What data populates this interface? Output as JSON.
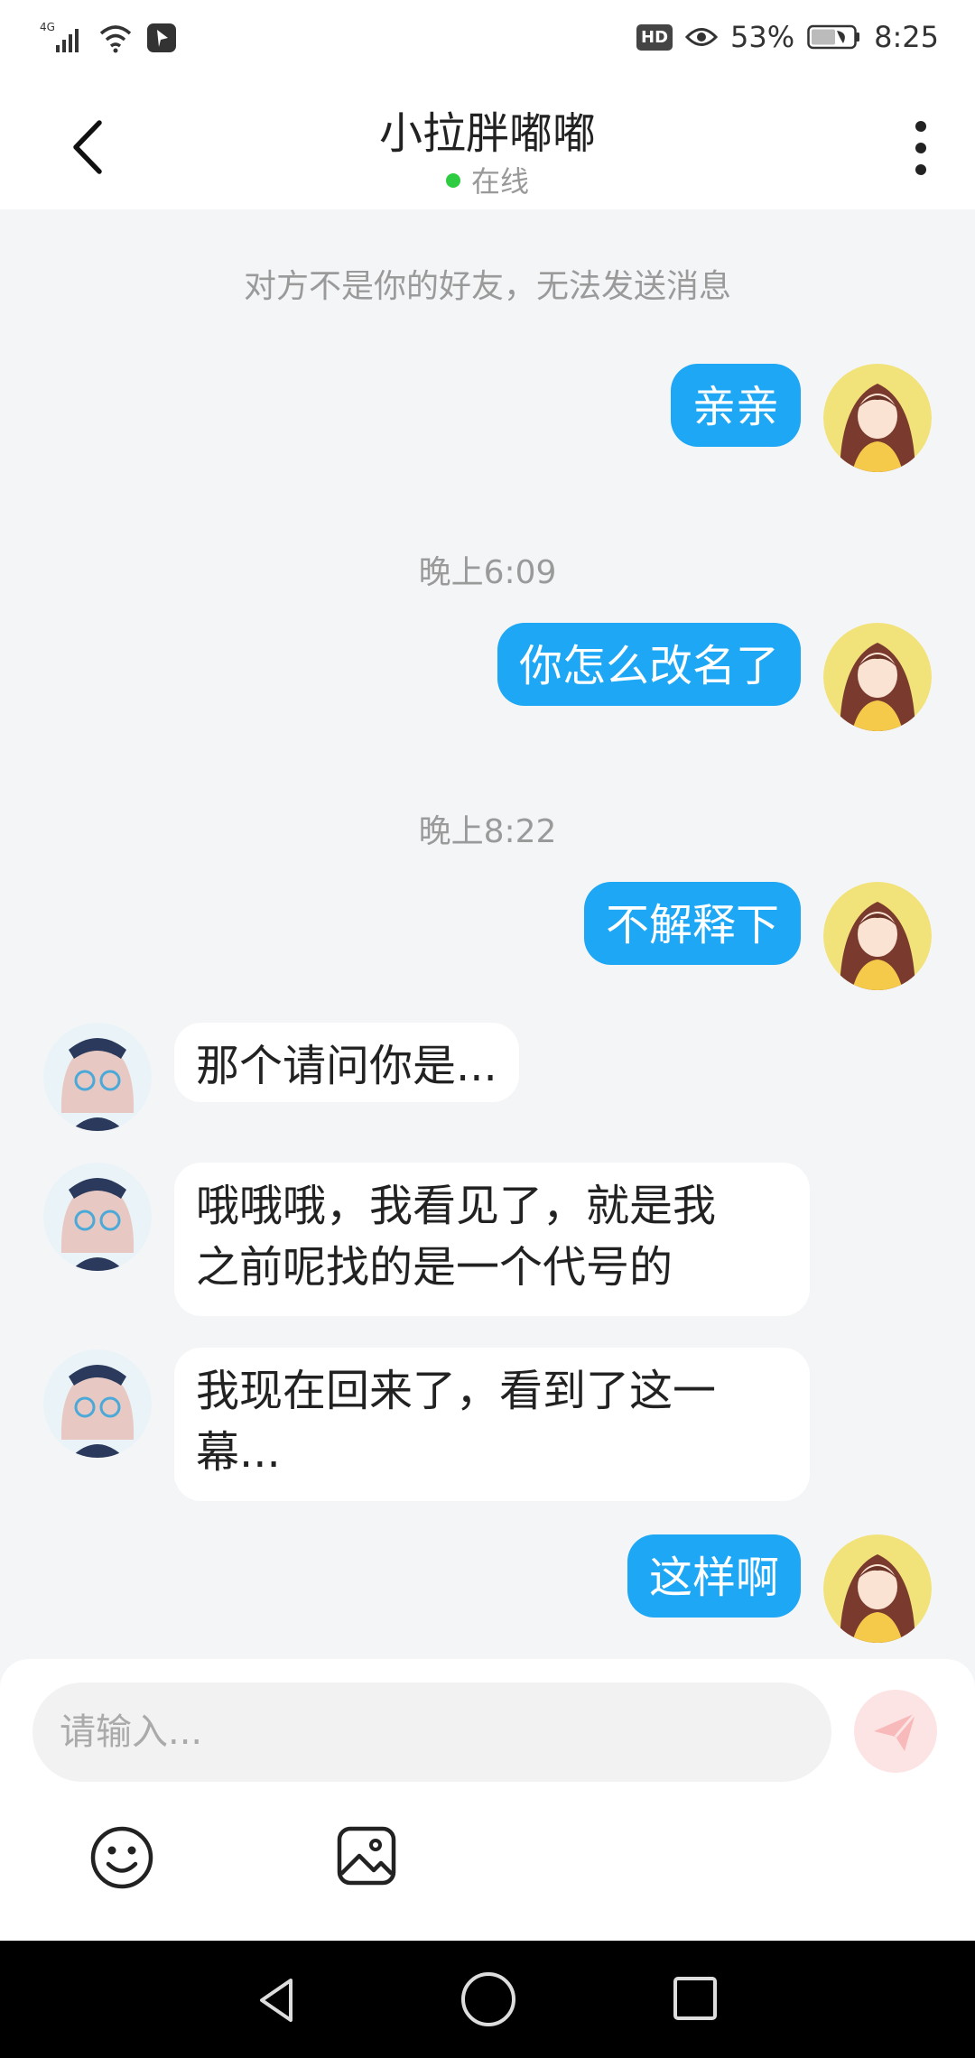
{
  "status_bar": {
    "network": "4G",
    "hd_badge": "HD",
    "battery": "53%",
    "time": "8:25",
    "icons": [
      "signal-icon",
      "wifi-icon",
      "app-notification-icon",
      "hd-icon",
      "eye-icon",
      "battery-icon"
    ]
  },
  "header": {
    "title": "小拉胖嘟嘟",
    "status": "在线",
    "status_color": "#2ecc40"
  },
  "chat": {
    "notice": "对方不是你的好友，无法发送消息",
    "timestamps": [
      "晚上6:09",
      "晚上8:22"
    ],
    "messages": [
      {
        "from": "me",
        "text": "亲亲"
      },
      {
        "from": "me",
        "text": "你怎么改名了"
      },
      {
        "from": "me",
        "text": "不解释下"
      },
      {
        "from": "other",
        "text": "那个请问你是..."
      },
      {
        "from": "other",
        "text": "哦哦哦，我看见了，就是我\n之前呢找的是一个代号的"
      },
      {
        "from": "other",
        "text": "我现在回来了，看到了这一\n幕..."
      },
      {
        "from": "me",
        "text": "这样啊"
      }
    ]
  },
  "composer": {
    "placeholder": "请输入...",
    "icons": [
      "send-icon",
      "emoji-icon",
      "image-icon"
    ]
  },
  "colors": {
    "my_bubble": "#1ea7f5",
    "other_bubble": "#ffffff",
    "background": "#f4f5f7",
    "send_button": "#fde4e4"
  }
}
